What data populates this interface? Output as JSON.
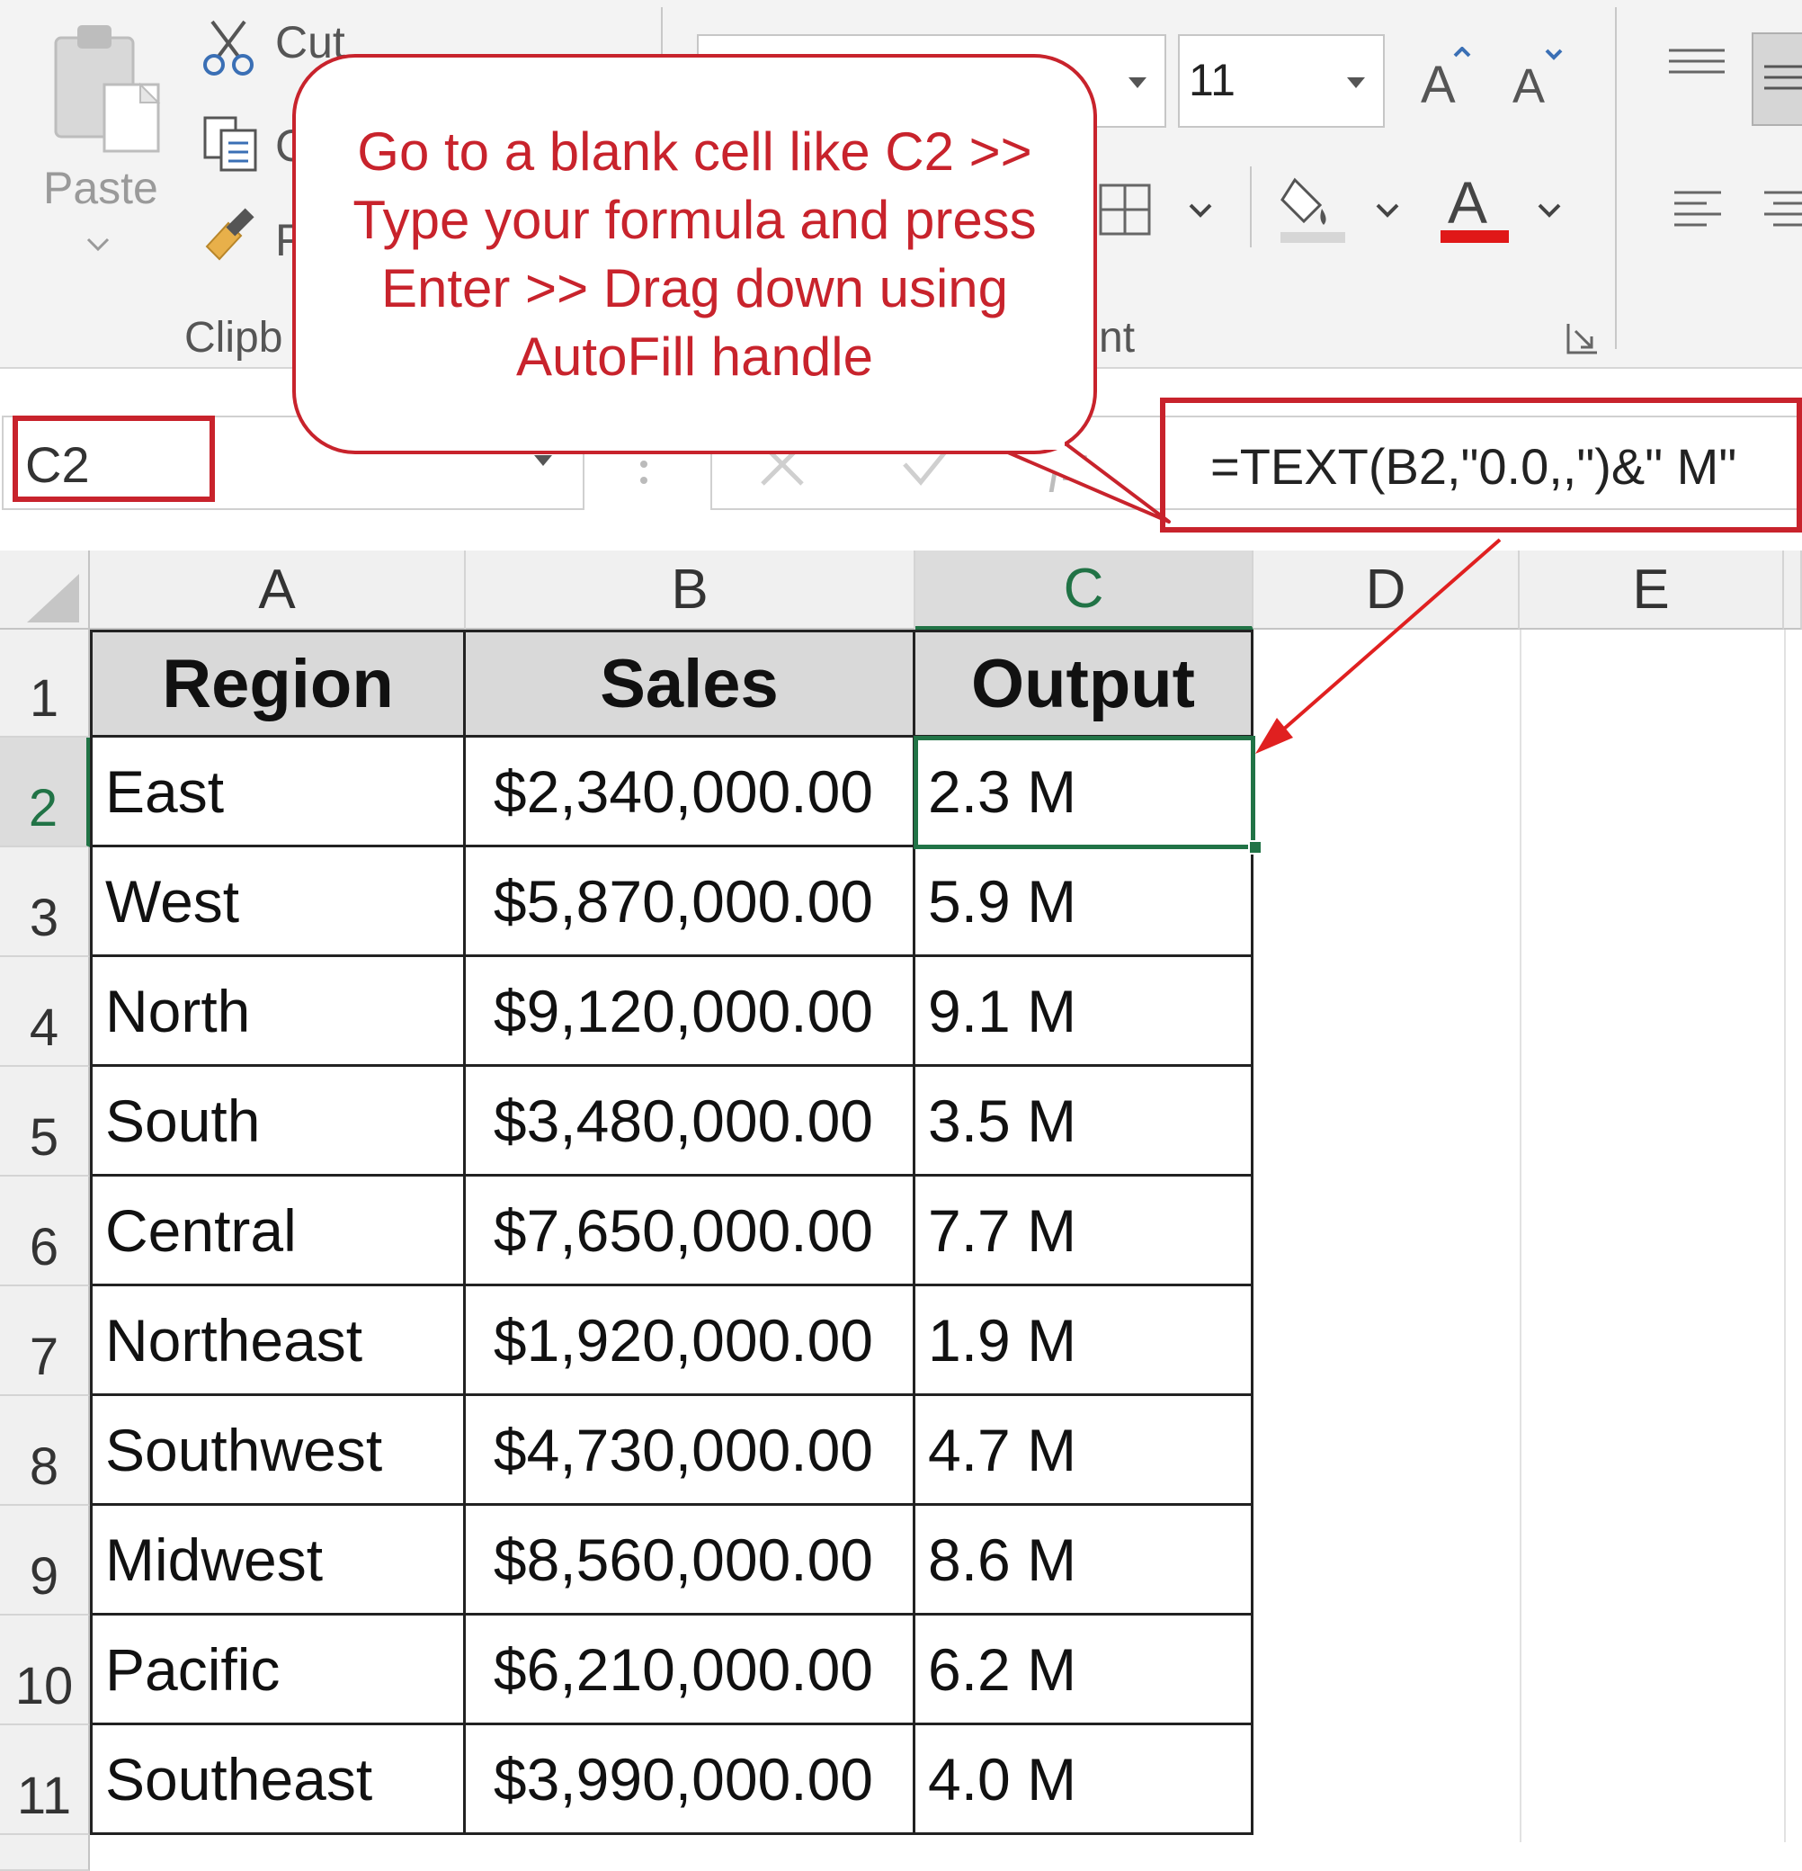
{
  "ribbon": {
    "clipboard": {
      "paste_label": "Paste",
      "cut_label": "Cut",
      "copy_label": "C",
      "format_painter_label": "F",
      "group_label": "Clipb"
    },
    "font": {
      "size": "11",
      "group_label": "nt"
    }
  },
  "callout": {
    "lines": [
      "Go to a blank cell like C2 >>",
      "Type your formula and press",
      "Enter >> Drag down using",
      "AutoFill handle"
    ]
  },
  "formula_bar": {
    "name_box": "C2",
    "formula": "=TEXT(B2,\"0.0,,\")&\" M\""
  },
  "sheet": {
    "columns": [
      "A",
      "B",
      "C",
      "D",
      "E"
    ],
    "selected_column": "C",
    "selected_row": "2",
    "headers": [
      "Region",
      "Sales",
      "Output"
    ],
    "rows": [
      {
        "num": "1"
      },
      {
        "num": "2",
        "region": "East",
        "sales": "$2,340,000.00",
        "output": "2.3 M"
      },
      {
        "num": "3",
        "region": "West",
        "sales": "$5,870,000.00",
        "output": "5.9 M"
      },
      {
        "num": "4",
        "region": "North",
        "sales": "$9,120,000.00",
        "output": "9.1 M"
      },
      {
        "num": "5",
        "region": "South",
        "sales": "$3,480,000.00",
        "output": "3.5 M"
      },
      {
        "num": "6",
        "region": "Central",
        "sales": "$7,650,000.00",
        "output": "7.7 M"
      },
      {
        "num": "7",
        "region": "Northeast",
        "sales": "$1,920,000.00",
        "output": "1.9 M"
      },
      {
        "num": "8",
        "region": "Southwest",
        "sales": "$4,730,000.00",
        "output": "4.7 M"
      },
      {
        "num": "9",
        "region": "Midwest",
        "sales": "$8,560,000.00",
        "output": "8.6 M"
      },
      {
        "num": "10",
        "region": "Pacific",
        "sales": "$6,210,000.00",
        "output": "6.2 M"
      },
      {
        "num": "11",
        "region": "Southeast",
        "sales": "$3,990,000.00",
        "output": "4.0 M"
      }
    ]
  },
  "colors": {
    "accent_red": "#c8232c",
    "excel_green": "#217346",
    "header_fill": "#d9d9d9"
  }
}
